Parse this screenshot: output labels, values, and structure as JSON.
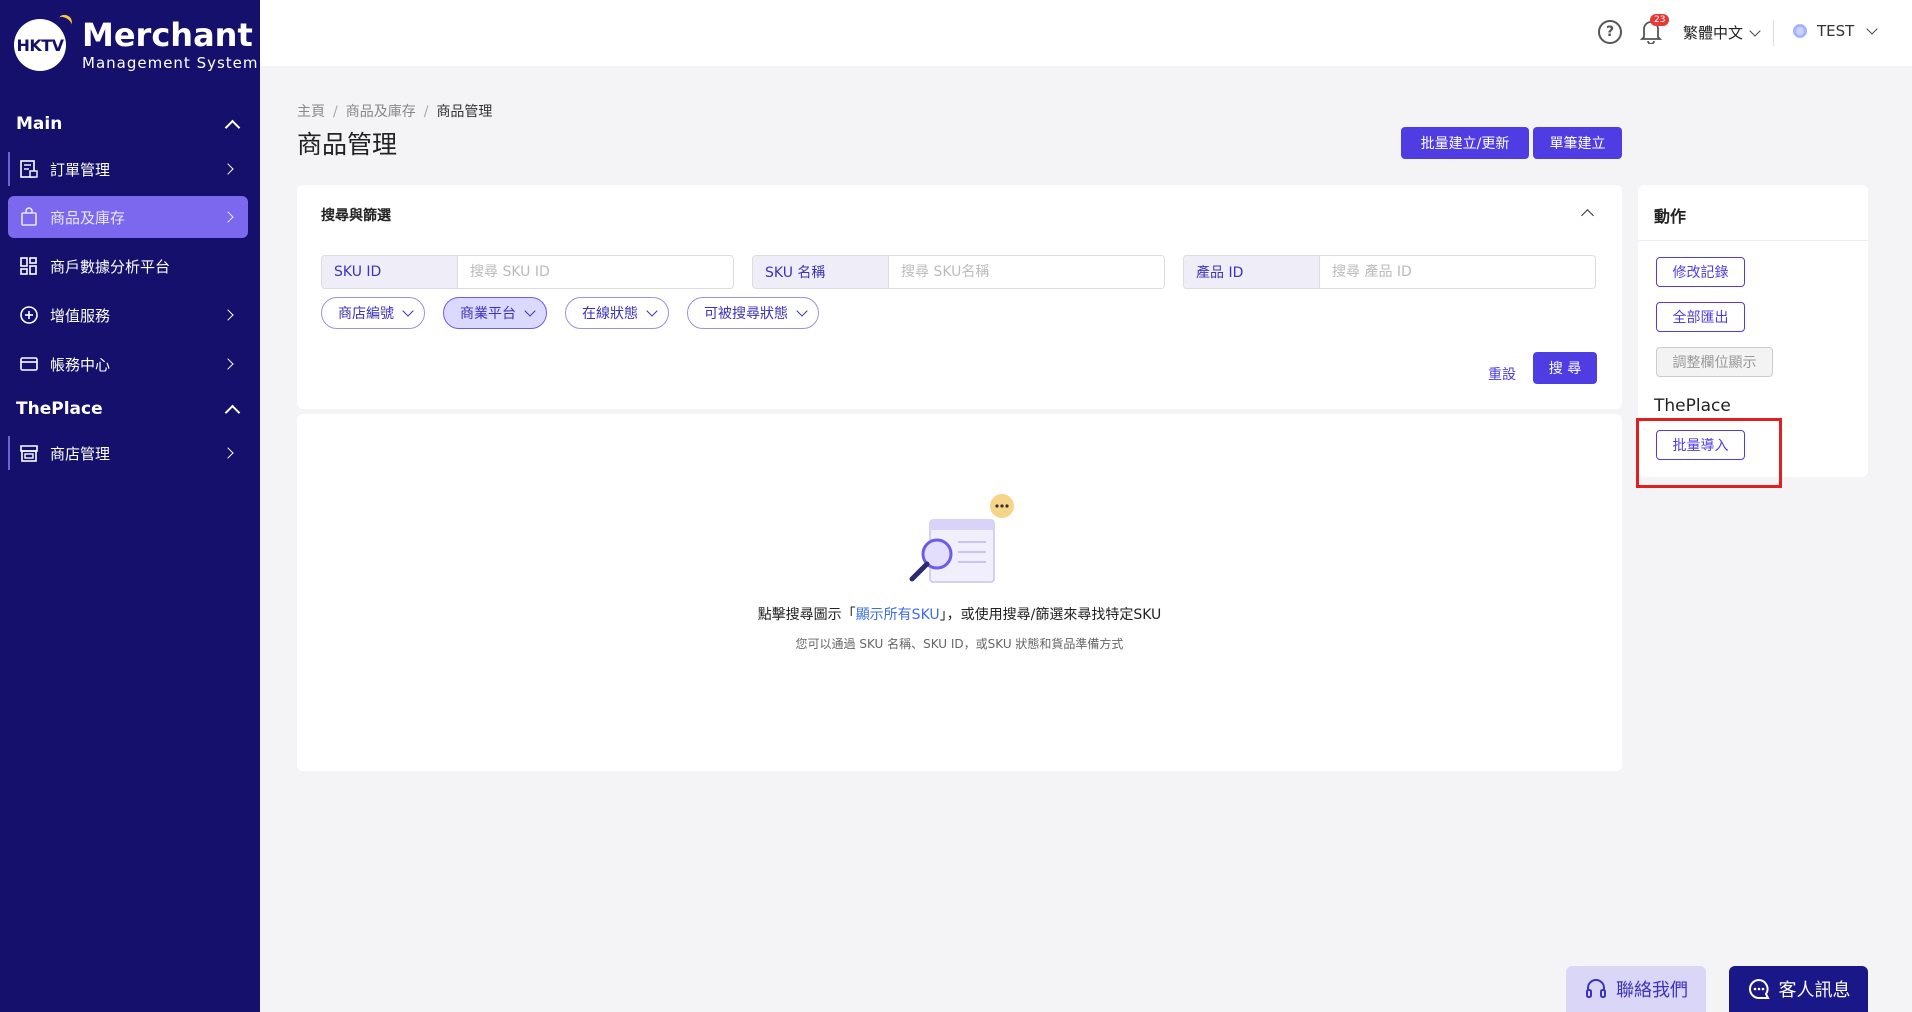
{
  "brand": {
    "badge": "HKTV",
    "title": "Merchant",
    "subtitle": "Management System"
  },
  "sidebar": {
    "sections": [
      {
        "title": "Main",
        "items": [
          {
            "label": "訂單管理",
            "icon": "order-icon"
          },
          {
            "label": "商品及庫存",
            "icon": "shopping-bag-icon",
            "active": true
          },
          {
            "label": "商戶數據分析平台",
            "icon": "dashboard-grid-icon"
          },
          {
            "label": "增值服務",
            "icon": "plus-circle-icon"
          },
          {
            "label": "帳務中心",
            "icon": "credit-card-icon"
          }
        ]
      },
      {
        "title": "ThePlace",
        "items": [
          {
            "label": "商店管理",
            "icon": "store-icon"
          }
        ]
      }
    ]
  },
  "topbar": {
    "notification_count": "23",
    "language": "繁體中文",
    "user": "TEST"
  },
  "page": {
    "breadcrumb": [
      "主頁",
      "商品及庫存",
      "商品管理"
    ],
    "title": "商品管理",
    "bulk_button": "批量建立/更新",
    "single_button": "單筆建立"
  },
  "search": {
    "title": "搜尋與篩選",
    "fields": [
      {
        "label": "SKU ID",
        "placeholder": "搜尋 SKU ID"
      },
      {
        "label": "SKU 名稱",
        "placeholder": "搜尋 SKU名稱"
      },
      {
        "label": "產品 ID",
        "placeholder": "搜尋 產品 ID"
      }
    ],
    "filters": [
      "商店編號",
      "商業平台",
      "在線狀態",
      "可被搜尋狀態"
    ],
    "reset_label": "重設",
    "search_label": "搜 尋"
  },
  "empty_state": {
    "prefix": "點擊搜尋圖示「",
    "link": "顯示所有SKU",
    "suffix": "」，或使用搜尋/篩選來尋找特定SKU",
    "sub": "您可以通過 SKU 名稱、SKU ID，或SKU 狀態和貨品準備方式"
  },
  "actions": {
    "title": "動作",
    "history": "修改記錄",
    "export_all": "全部匯出",
    "adjust_columns": "調整欄位顯示",
    "theplace_label": "ThePlace",
    "bulk_import": "批量導入"
  },
  "floating": {
    "contact": "聯絡我們",
    "chat": "客人訊息"
  },
  "colors": {
    "sidebar_bg": "#14106b",
    "primary": "#4f3de3",
    "active_nav": "#7b68ee",
    "highlight_box": "#e02020"
  }
}
